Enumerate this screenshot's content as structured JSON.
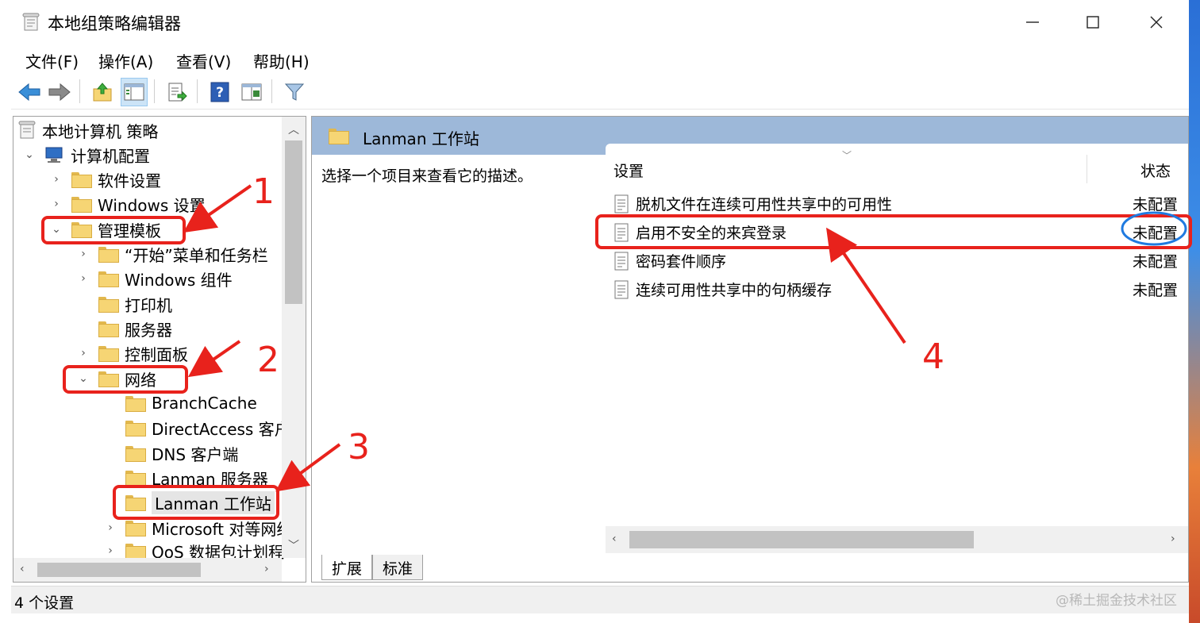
{
  "window": {
    "title": "本地组策略编辑器",
    "minimize_icon": "minimize-icon",
    "maximize_icon": "maximize-icon",
    "close_icon": "close-icon"
  },
  "menubar": {
    "items": [
      "文件(F)",
      "操作(A)",
      "查看(V)",
      "帮助(H)"
    ]
  },
  "toolbar": {
    "icons": [
      "back-arrow-icon",
      "forward-arrow-icon",
      "up-folder-icon",
      "show-hide-tree-icon",
      "export-list-icon",
      "help-icon",
      "extended-view-icon",
      "filter-icon"
    ]
  },
  "tree": {
    "items": [
      {
        "label": "本地计算机 策略",
        "icon": "policy-icon",
        "expander": ""
      },
      {
        "label": "计算机配置",
        "icon": "computer-icon",
        "expander": "⌄"
      },
      {
        "label": "软件设置",
        "icon": "folder-icon",
        "expander": "›"
      },
      {
        "label": "Windows 设置",
        "icon": "folder-icon",
        "expander": "›"
      },
      {
        "label": "管理模板",
        "icon": "folder-icon",
        "expander": "⌄"
      },
      {
        "label": "“开始”菜单和任务栏",
        "icon": "folder-icon",
        "expander": "›"
      },
      {
        "label": "Windows 组件",
        "icon": "folder-icon",
        "expander": "›"
      },
      {
        "label": "打印机",
        "icon": "folder-icon",
        "expander": ""
      },
      {
        "label": "服务器",
        "icon": "folder-icon",
        "expander": ""
      },
      {
        "label": "控制面板",
        "icon": "folder-icon",
        "expander": "›"
      },
      {
        "label": "网络",
        "icon": "folder-icon",
        "expander": "⌄"
      },
      {
        "label": "BranchCache",
        "icon": "folder-icon",
        "expander": ""
      },
      {
        "label": "DirectAccess 客户",
        "icon": "folder-icon",
        "expander": ""
      },
      {
        "label": "DNS 客户端",
        "icon": "folder-icon",
        "expander": ""
      },
      {
        "label": "Lanman 服务器",
        "icon": "folder-icon",
        "expander": ""
      },
      {
        "label": "Lanman 工作站",
        "icon": "folder-icon",
        "expander": "",
        "selected": true
      },
      {
        "label": "Microsoft 对等网络",
        "icon": "folder-icon",
        "expander": "›"
      },
      {
        "label": "QoS 数据包计划程",
        "icon": "folder-icon",
        "expander": "›"
      }
    ]
  },
  "right_pane": {
    "header_title": "Lanman 工作站",
    "description": "选择一个项目来查看它的描述。",
    "columns": {
      "setting": "设置",
      "state": "状态"
    },
    "rows": [
      {
        "name": "脱机文件在连续可用性共享中的可用性",
        "state": "未配置"
      },
      {
        "name": "启用不安全的来宾登录",
        "state": "未配置"
      },
      {
        "name": "密码套件顺序",
        "state": "未配置"
      },
      {
        "name": "连续可用性共享中的句柄缓存",
        "state": "未配置"
      }
    ],
    "tabs": [
      "扩展",
      "标准"
    ]
  },
  "statusbar": {
    "text": "4 个设置"
  },
  "watermark": "@稀土掘金技术社区",
  "annotations": {
    "labels": [
      "1",
      "2",
      "3",
      "4"
    ],
    "color": "#e8221c",
    "circle_color": "#1f7ae0"
  }
}
